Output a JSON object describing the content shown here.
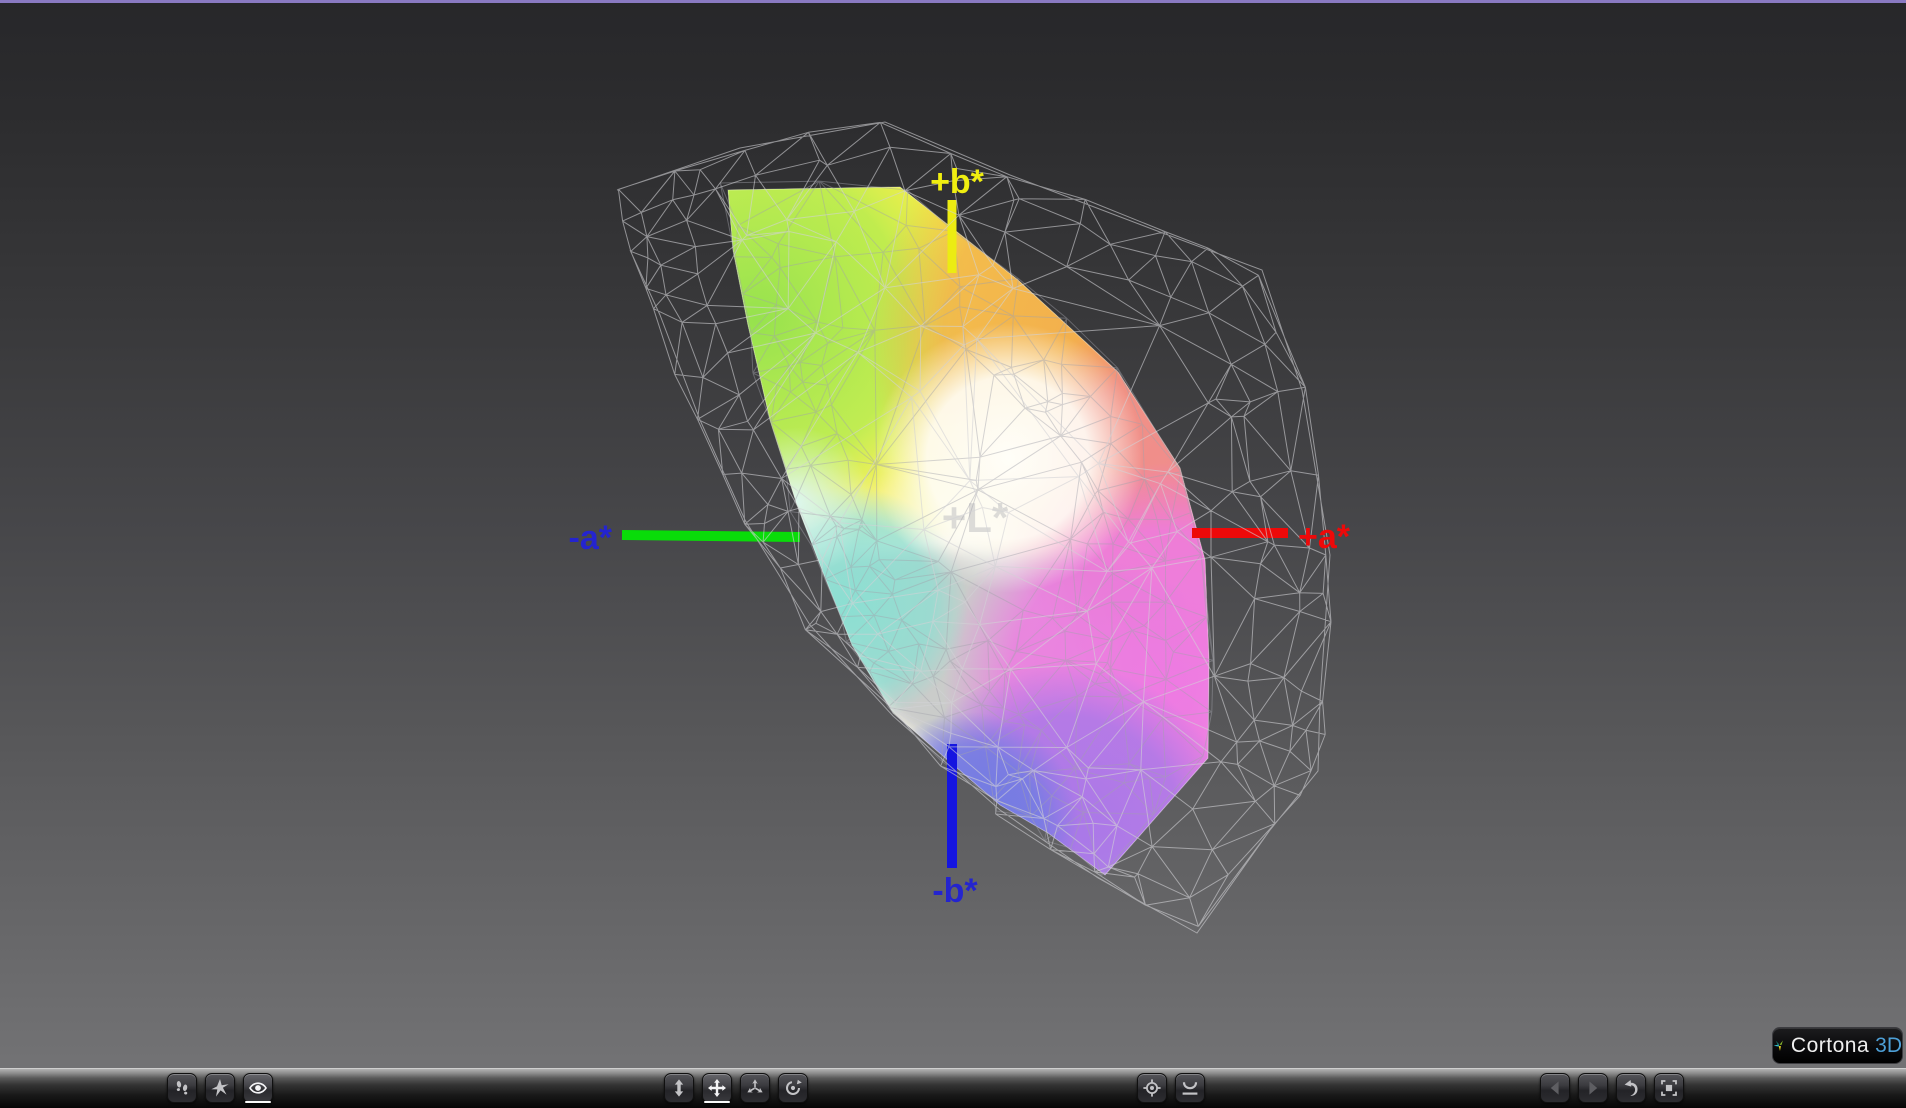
{
  "viewer": {
    "labels": {
      "axis_pos_b": "+b*",
      "axis_neg_a": "-a*",
      "axis_pos_a": "+a*",
      "axis_neg_b": "-b*",
      "axis_pos_l": "+L*"
    },
    "colors": {
      "axis_a_positive_line": "#ee0909",
      "axis_a_negative_line": "#09dc09",
      "axis_b_positive_line": "#ecec12",
      "axis_b_negative_line": "#1515e0",
      "label_pos_a_text": "#ee0909",
      "label_pos_b_text": "#f0ee10",
      "label_neg_a_text": "#2424cf",
      "label_neg_b_text": "#2424cf",
      "label_pos_l_text": "#c8c8c8",
      "wireframe": "#d2d2d6",
      "background_top": "#28282b",
      "background_bottom": "#757577",
      "accent_top_line": "#8a7ac2"
    }
  },
  "toolbar": {
    "groups": [
      {
        "name": "navigation-modes",
        "buttons": [
          {
            "icon": "walk-icon",
            "state": "normal"
          },
          {
            "icon": "fly-icon",
            "state": "normal"
          },
          {
            "icon": "examine-eye-icon",
            "state": "active"
          }
        ]
      },
      {
        "name": "camera-tools",
        "buttons": [
          {
            "icon": "zoom-vertical-arrows-icon",
            "state": "normal"
          },
          {
            "icon": "pan-arrows-icon",
            "state": "active"
          },
          {
            "icon": "rotate-arrows-icon",
            "state": "normal"
          },
          {
            "icon": "spin-orbit-icon",
            "state": "normal"
          }
        ]
      },
      {
        "name": "view-tools",
        "buttons": [
          {
            "icon": "seek-target-icon",
            "state": "normal"
          },
          {
            "icon": "upright-horizon-icon",
            "state": "normal"
          }
        ]
      },
      {
        "name": "history-tools",
        "buttons": [
          {
            "icon": "previous-view-icon",
            "state": "disabled"
          },
          {
            "icon": "next-view-icon",
            "state": "disabled"
          },
          {
            "icon": "restore-view-icon",
            "state": "normal"
          },
          {
            "icon": "fit-to-window-icon",
            "state": "normal"
          }
        ]
      }
    ]
  },
  "branding": {
    "product_name": "Cortona",
    "product_suffix": "3D"
  }
}
